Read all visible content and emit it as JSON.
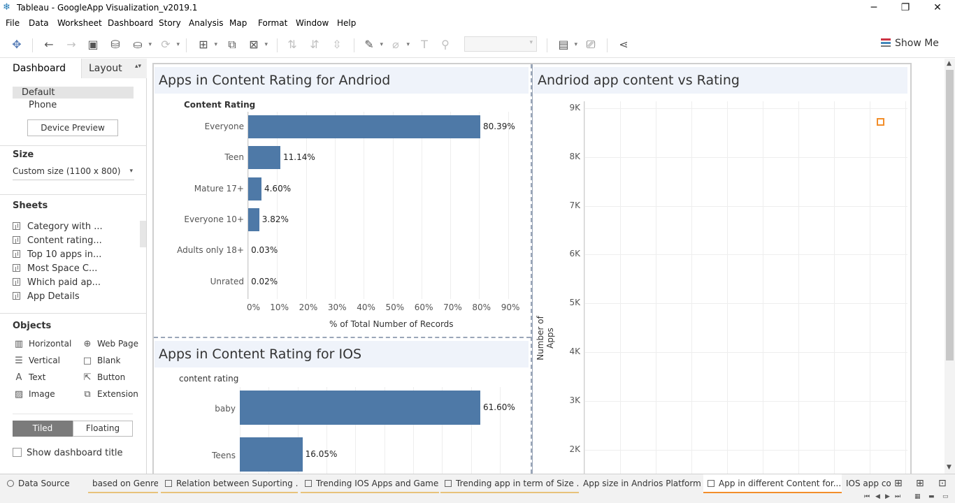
{
  "window": {
    "title": "Tableau - GoogleApp Visualization_v2019.1",
    "min": "─",
    "max": "❐",
    "close": "✕"
  },
  "menu": [
    "File",
    "Data",
    "Worksheet",
    "Dashboard",
    "Story",
    "Analysis",
    "Map",
    "Format",
    "Window",
    "Help"
  ],
  "toolbar": {
    "show_me": "Show Me"
  },
  "left": {
    "tab_dashboard": "Dashboard",
    "tab_layout": "Layout",
    "device_default": "Default",
    "device_phone": "Phone",
    "device_preview": "Device Preview",
    "size_heading": "Size",
    "size_value": "Custom size (1100 x 800)",
    "sheets_heading": "Sheets",
    "sheets": [
      "Category with ...",
      "Content rating...",
      "Top 10 apps in...",
      "Most Space C...",
      "Which paid ap...",
      "App Details"
    ],
    "objects_heading": "Objects",
    "objects": [
      {
        "label": "Horizontal",
        "icon": "▥"
      },
      {
        "label": "Web Page",
        "icon": "⊕"
      },
      {
        "label": "Vertical",
        "icon": "☰"
      },
      {
        "label": "Blank",
        "icon": "□"
      },
      {
        "label": "Text",
        "icon": "A"
      },
      {
        "label": "Button",
        "icon": "⇱"
      },
      {
        "label": "Image",
        "icon": "▨"
      },
      {
        "label": "Extension",
        "icon": "⧉"
      }
    ],
    "tiled": "Tiled",
    "floating": "Floating",
    "show_title": "Show dashboard title"
  },
  "android_chart": {
    "title": "Apps in Content Rating for Andriod",
    "header": "Content Rating",
    "xlabel": "% of Total Number of Records",
    "ticks": [
      "0%",
      "10%",
      "20%",
      "30%",
      "40%",
      "50%",
      "60%",
      "70%",
      "80%",
      "90%"
    ]
  },
  "ios_chart": {
    "title": "Apps in Content Rating for IOS",
    "header": "content rating"
  },
  "scatter": {
    "title": "Andriod app content vs Rating",
    "ylabel": "Number of Apps",
    "yticks": [
      "9K",
      "8K",
      "7K",
      "6K",
      "5K",
      "4K",
      "3K",
      "2K"
    ]
  },
  "chart_data": [
    {
      "type": "bar",
      "title": "Apps in Content Rating for Andriod",
      "categories": [
        "Everyone",
        "Teen",
        "Mature 17+",
        "Everyone 10+",
        "Adults only 18+",
        "Unrated"
      ],
      "values": [
        80.39,
        11.14,
        4.6,
        3.82,
        0.03,
        0.02
      ],
      "labels": [
        "80.39%",
        "11.14%",
        "4.60%",
        "3.82%",
        "0.03%",
        "0.02%"
      ],
      "xlabel": "% of Total Number of Records",
      "xlim": [
        0,
        90
      ]
    },
    {
      "type": "bar",
      "title": "Apps in Content Rating for IOS",
      "categories": [
        "baby",
        "Teens"
      ],
      "values": [
        61.6,
        16.05
      ],
      "labels": [
        "61.60%",
        "16.05%"
      ]
    },
    {
      "type": "scatter",
      "title": "Andriod app content vs Rating",
      "ylabel": "Number of Apps",
      "ylim": [
        2000,
        9000
      ],
      "points": [
        {
          "y": 8710
        }
      ]
    }
  ],
  "bottom_tabs": [
    {
      "label": "Data Source",
      "kind": "ds"
    },
    {
      "label": "based on Genre",
      "kind": "plain"
    },
    {
      "label": "Relation between Suporting ...",
      "kind": "dash"
    },
    {
      "label": "Trending IOS Apps and Games",
      "kind": "dash"
    },
    {
      "label": "Trending app in term of Size ...",
      "kind": "dash"
    },
    {
      "label": "App size in Andrios Platform",
      "kind": "plain"
    },
    {
      "label": "App in different Content for...",
      "kind": "dash"
    },
    {
      "label": "IOS app co",
      "kind": "plain"
    }
  ]
}
